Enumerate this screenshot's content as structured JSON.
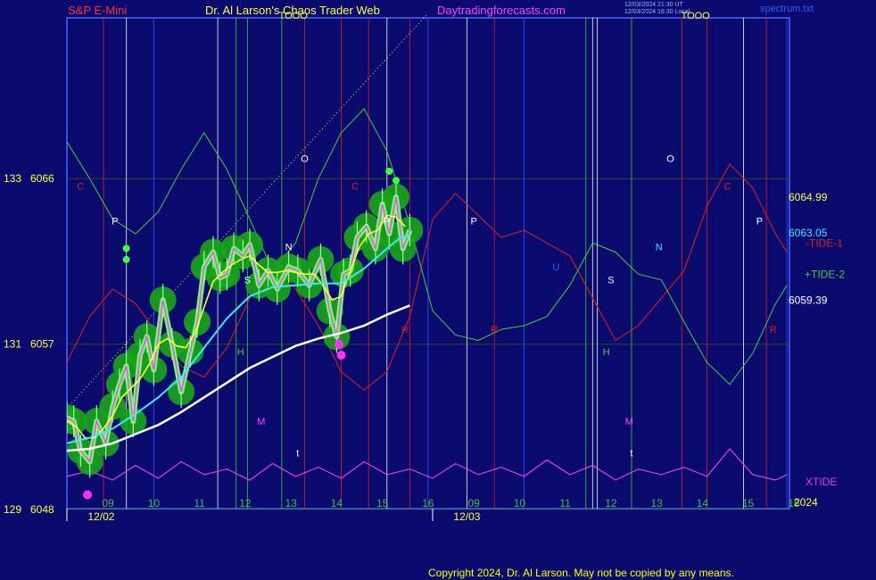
{
  "header": {
    "symbol": "S&P E-Mini",
    "title": "Dr. Al Larson's Chaos Trader Web",
    "site": "Daytradingforecasts.com",
    "timestamp_line1": "12/03/2024 21:30 UT",
    "timestamp_line2": "12/03/2024 16:30 Local",
    "file": "spectrum.txt"
  },
  "footer": {
    "copyright": "Copyright 2024, Dr. Al Larson. May not be copied by any means."
  },
  "colors": {
    "background": "#0a0a6e",
    "price": "#2cd62c",
    "tide1": "#e02020",
    "tide2": "#40d040",
    "xtide": "#e040e0",
    "cyan_avg": "#40e8ff",
    "white_avg": "#ffffff",
    "fast_avg": "#ffff40",
    "fast_inner": "#ff40ff"
  },
  "chart_data": {
    "type": "line",
    "y_labels": [
      {
        "left": "133",
        "price": "6066",
        "y": 6066
      },
      {
        "left": "131",
        "price": "6057",
        "y": 6057
      },
      {
        "left": "129",
        "price": "6048",
        "y": 6048
      }
    ],
    "ylim": [
      6048,
      6065.3
    ],
    "x_hours": [
      "09",
      "10",
      "11",
      "12",
      "13",
      "14",
      "15",
      "16",
      "09",
      "10",
      "11",
      "12",
      "13",
      "14",
      "15",
      "16"
    ],
    "day_labels": [
      "12/02",
      "12/03"
    ],
    "year_label": "2024",
    "right_labels": [
      {
        "text": "6064.99",
        "y": 6064.99
      },
      {
        "text": "6063.05",
        "y": 6063.05
      },
      {
        "text": "-TIDE-1",
        "y": 6062.5
      },
      {
        "text": "+TIDE-2",
        "y": 6060.8
      },
      {
        "text": "6059.39",
        "y": 6059.39
      },
      {
        "text": "XTIDE",
        "y": 6049.5
      }
    ],
    "vertical_markers": [
      {
        "t": 0.8,
        "kind": "red"
      },
      {
        "t": 1.3,
        "kind": "white"
      },
      {
        "t": 1.9,
        "kind": "blue"
      },
      {
        "t": 3.3,
        "kind": "white"
      },
      {
        "t": 3.7,
        "kind": "green"
      },
      {
        "t": 3.95,
        "kind": "green"
      },
      {
        "t": 4.7,
        "kind": "green"
      },
      {
        "t": 5.2,
        "kind": "red"
      },
      {
        "t": 6.0,
        "kind": "red"
      },
      {
        "t": 6.6,
        "kind": "red"
      },
      {
        "t": 7.0,
        "kind": "white"
      },
      {
        "t": 7.5,
        "kind": "red"
      },
      {
        "t": 7.9,
        "kind": "blue"
      },
      {
        "t": 8.75,
        "kind": "white"
      },
      {
        "t": 9.35,
        "kind": "red"
      },
      {
        "t": 10.0,
        "kind": "blue"
      },
      {
        "t": 11.35,
        "kind": "green"
      },
      {
        "t": 11.5,
        "kind": "white"
      },
      {
        "t": 11.6,
        "kind": "white"
      },
      {
        "t": 12.35,
        "kind": "green"
      },
      {
        "t": 13.45,
        "kind": "red"
      },
      {
        "t": 14.0,
        "kind": "red"
      },
      {
        "t": 14.8,
        "kind": "white"
      },
      {
        "t": 15.3,
        "kind": "red"
      },
      {
        "t": 15.75,
        "kind": "blue"
      }
    ],
    "markers": [
      {
        "text": "C",
        "t": 0.3,
        "y": 6065.4,
        "color": "#e02020"
      },
      {
        "text": "P",
        "t": 1.05,
        "y": 6063.5,
        "color": "#ffffff"
      },
      {
        "text": "TOOO",
        "t": 4.95,
        "y": 6074.7,
        "color": "#ffff40"
      },
      {
        "text": "O",
        "t": 5.2,
        "y": 6066.9,
        "color": "#ffffff"
      },
      {
        "text": "S",
        "t": 3.95,
        "y": 6060.3,
        "color": "#ffffff"
      },
      {
        "text": "N",
        "t": 4.85,
        "y": 6062.1,
        "color": "#ffffff"
      },
      {
        "text": "C",
        "t": 6.3,
        "y": 6065.4,
        "color": "#e02020"
      },
      {
        "text": "P",
        "t": 7.0,
        "y": 6063.5,
        "color": "#ffffff"
      },
      {
        "text": "H",
        "t": 3.8,
        "y": 6056.4,
        "color": "#40d040"
      },
      {
        "text": "M",
        "t": 4.25,
        "y": 6052.6,
        "color": "#ff40ff"
      },
      {
        "text": "R",
        "t": 7.4,
        "y": 6057.6,
        "color": "#e02020"
      },
      {
        "text": "P",
        "t": 8.9,
        "y": 6063.5,
        "color": "#ffffff"
      },
      {
        "text": "R",
        "t": 9.35,
        "y": 6057.6,
        "color": "#e02020"
      },
      {
        "text": "t",
        "t": 5.05,
        "y": 6050.9,
        "color": "#ffffff"
      },
      {
        "text": "TOOO",
        "t": 13.75,
        "y": 6074.7,
        "color": "#ffff40"
      },
      {
        "text": "O",
        "t": 13.2,
        "y": 6066.9,
        "color": "#ffffff"
      },
      {
        "text": "U",
        "t": 10.7,
        "y": 6061.0,
        "color": "#3060ff"
      },
      {
        "text": "S",
        "t": 11.9,
        "y": 6060.3,
        "color": "#ffffff"
      },
      {
        "text": "N",
        "t": 12.95,
        "y": 6062.1,
        "color": "#40e8ff"
      },
      {
        "text": "H",
        "t": 11.8,
        "y": 6056.4,
        "color": "#40d040"
      },
      {
        "text": "M",
        "t": 12.3,
        "y": 6052.6,
        "color": "#ff40ff"
      },
      {
        "text": "t",
        "t": 12.35,
        "y": 6050.9,
        "color": "#ffffff"
      },
      {
        "text": "C",
        "t": 14.45,
        "y": 6065.4,
        "color": "#e02020"
      },
      {
        "text": "P",
        "t": 15.15,
        "y": 6063.5,
        "color": "#ffffff"
      },
      {
        "text": "R",
        "t": 15.45,
        "y": 6057.6,
        "color": "#e02020"
      }
    ],
    "series": [
      {
        "key": "price",
        "t": [
          0,
          0.15,
          0.3,
          0.5,
          0.65,
          0.85,
          1.0,
          1.15,
          1.3,
          1.45,
          1.6,
          1.75,
          1.9,
          2.1,
          2.3,
          2.5,
          2.7,
          2.85,
          3.0,
          3.2,
          3.35,
          3.5,
          3.65,
          3.85,
          4.0,
          4.2,
          4.4,
          4.6,
          4.85,
          5.05,
          5.3,
          5.55,
          5.75,
          5.9,
          6.05,
          6.2,
          6.35,
          6.55,
          6.75,
          6.9,
          7.05,
          7.2,
          7.35,
          7.5
        ],
        "y": [
          6053.0,
          6052.8,
          6051.2,
          6050.6,
          6052.8,
          6051.6,
          6053.6,
          6054.8,
          6055.8,
          6052.8,
          6056.4,
          6057.4,
          6055.6,
          6059.4,
          6057.0,
          6054.4,
          6056.6,
          6058.2,
          6061.2,
          6062.0,
          6060.6,
          6060.8,
          6062.2,
          6061.8,
          6062.4,
          6060.2,
          6061.0,
          6060.0,
          6061.2,
          6061.0,
          6060.2,
          6061.6,
          6058.8,
          6057.4,
          6060.8,
          6061.0,
          6062.8,
          6063.4,
          6062.2,
          6064.6,
          6063.0,
          6065.0,
          6062.2,
          6063.2
        ]
      },
      {
        "key": "fast_avg",
        "t": [
          0,
          0.2,
          0.4,
          0.6,
          0.8,
          1.0,
          1.2,
          1.4,
          1.6,
          1.8,
          2.0,
          2.2,
          2.4,
          2.6,
          2.8,
          3.0,
          3.2,
          3.4,
          3.6,
          3.8,
          4.0,
          4.2,
          4.4,
          4.6,
          4.8,
          5.0,
          5.2,
          5.4,
          5.6,
          5.8,
          6.0,
          6.2,
          6.4,
          6.6,
          6.8,
          7.0,
          7.2,
          7.4
        ],
        "y": [
          6052.8,
          6052.5,
          6051.9,
          6051.9,
          6052.4,
          6053.1,
          6054.1,
          6054.6,
          6055.1,
          6055.9,
          6057.0,
          6057.3,
          6056.9,
          6056.8,
          6057.6,
          6059.0,
          6060.4,
          6060.9,
          6061.3,
          6061.6,
          6061.8,
          6061.3,
          6060.9,
          6060.9,
          6061.0,
          6060.9,
          6060.8,
          6060.8,
          6060.2,
          6059.4,
          6059.6,
          6061.0,
          6062.3,
          6063.0,
          6063.2,
          6064.0,
          6063.9,
          6063.4
        ]
      },
      {
        "key": "cyan_avg",
        "t": [
          0,
          0.5,
          1.0,
          1.5,
          2.0,
          2.5,
          3.0,
          3.5,
          4.0,
          4.5,
          5.0,
          5.5,
          6.0,
          6.5,
          7.0,
          7.3,
          7.5
        ],
        "y": [
          6051.6,
          6051.9,
          6052.4,
          6053.2,
          6054.1,
          6055.2,
          6056.8,
          6058.4,
          6059.6,
          6060.1,
          6060.2,
          6060.3,
          6060.3,
          6061.1,
          6062.2,
          6062.8,
          6062.9
        ]
      },
      {
        "key": "white_avg",
        "t": [
          0,
          0.5,
          1.0,
          1.5,
          2.0,
          2.5,
          3.0,
          3.5,
          4.0,
          4.5,
          5.0,
          5.5,
          6.0,
          6.5,
          7.0,
          7.5
        ],
        "y": [
          6051.2,
          6051.3,
          6051.6,
          6052.1,
          6052.6,
          6053.3,
          6054.1,
          6054.9,
          6055.7,
          6056.3,
          6056.9,
          6057.3,
          6057.6,
          6058.0,
          6058.6,
          6059.1
        ]
      },
      {
        "key": "tide1",
        "t": [
          0,
          0.5,
          1.0,
          1.5,
          2.0,
          2.5,
          3.0,
          3.5,
          4.0,
          4.5,
          5.0,
          5.5,
          6.0,
          6.5,
          7.0,
          7.5,
          8.0,
          8.5,
          9.0,
          9.5,
          10.0,
          10.5,
          11.0,
          11.5,
          12.0,
          12.5,
          13.0,
          13.5,
          14.0,
          14.5,
          15.0,
          15.5,
          15.75
        ],
        "y": [
          6056.0,
          6058.5,
          6060.0,
          6059.2,
          6057.5,
          6055.8,
          6055.2,
          6056.8,
          6059.5,
          6061.5,
          6060.0,
          6058.0,
          6055.5,
          6054.5,
          6055.5,
          6058.5,
          6063.8,
          6065.2,
          6064.0,
          6062.8,
          6063.2,
          6062.5,
          6061.8,
          6059.5,
          6057.2,
          6058.0,
          6059.5,
          6061.0,
          6064.5,
          6066.8,
          6065.5,
          6063.0,
          6062.0
        ]
      },
      {
        "key": "tide2",
        "t": [
          0,
          0.5,
          1.0,
          1.5,
          2.0,
          2.5,
          3.0,
          3.5,
          4.0,
          4.5,
          5.0,
          5.5,
          6.0,
          6.5,
          7.0,
          7.5,
          8.0,
          8.5,
          9.0,
          9.5,
          10.0,
          10.5,
          11.0,
          11.5,
          12.0,
          12.5,
          13.0,
          13.5,
          14.0,
          14.5,
          15.0,
          15.5,
          15.75
        ],
        "y": [
          6068.0,
          6066.0,
          6063.8,
          6063.0,
          6064.2,
          6066.5,
          6068.5,
          6066.5,
          6063.8,
          6061.0,
          6062.5,
          6066.0,
          6068.5,
          6069.8,
          6067.5,
          6063.5,
          6058.8,
          6057.5,
          6057.2,
          6057.8,
          6058.0,
          6058.5,
          6060.2,
          6062.5,
          6062.0,
          6060.8,
          6060.5,
          6058.2,
          6056.0,
          6054.8,
          6056.5,
          6059.2,
          6060.2
        ]
      },
      {
        "key": "xtide",
        "t": [
          0,
          0.5,
          1.0,
          1.5,
          2.0,
          2.5,
          3.0,
          3.5,
          4.0,
          4.5,
          5.0,
          5.5,
          6.0,
          6.5,
          7.0,
          7.5,
          8.0,
          8.5,
          9.0,
          9.5,
          10.0,
          10.5,
          11.0,
          11.5,
          12.0,
          12.5,
          13.0,
          13.5,
          14.0,
          14.5,
          15.0,
          15.5,
          15.75
        ],
        "y": [
          6049.8,
          6050.1,
          6049.6,
          6050.4,
          6049.7,
          6050.6,
          6049.9,
          6050.2,
          6049.6,
          6050.5,
          6049.8,
          6050.3,
          6049.7,
          6050.6,
          6049.9,
          6050.2,
          6049.7,
          6050.5,
          6049.9,
          6050.3,
          6049.8,
          6050.7,
          6049.9,
          6050.4,
          6049.6,
          6050.2,
          6049.9,
          6050.3,
          6049.8,
          6051.3,
          6049.9,
          6049.6,
          6049.9
        ]
      }
    ],
    "grid": true,
    "legend": "right"
  }
}
